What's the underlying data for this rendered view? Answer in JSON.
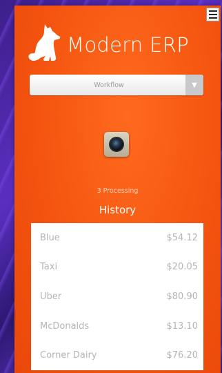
{
  "app": {
    "brand_title": "Modern ERP",
    "logo_icon": "dog-icon",
    "menu_icon": "hamburger-menu-icon",
    "accent_color": "#f4540f"
  },
  "workflow_select": {
    "value": "Workflow"
  },
  "camera": {
    "icon": "camera-lens-icon"
  },
  "status": {
    "processing": "3 Processing"
  },
  "history": {
    "title": "History",
    "items": [
      {
        "name": "Blue",
        "amount": "$54.12"
      },
      {
        "name": "Taxi",
        "amount": "$20.05"
      },
      {
        "name": "Uber",
        "amount": "$80.90"
      },
      {
        "name": "McDonalds",
        "amount": "$13.10"
      },
      {
        "name": "Corner Dairy",
        "amount": "$76.20"
      }
    ]
  }
}
